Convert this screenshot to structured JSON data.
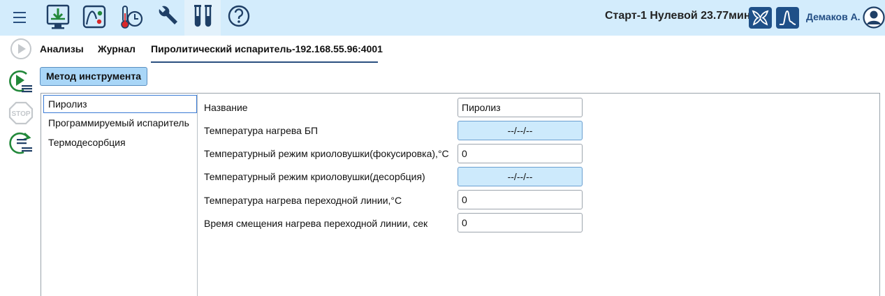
{
  "header": {
    "status_text": "Старт-1 Нулевой 23.77мин",
    "user_name": "Демаков А."
  },
  "toolbar_icons": [
    "monitor-download-icon",
    "chart-curve-icon",
    "thermometer-clock-icon",
    "wrench-icon",
    "test-tubes-icon",
    "help-icon"
  ],
  "colors": {
    "topbar": "#d3ecfc",
    "accent": "#1f5088",
    "green": "#22883a",
    "selected_button": "#a9d6f7",
    "value_blue": "#cdeafc"
  },
  "tabs": [
    {
      "label": "Анализы"
    },
    {
      "label": "Журнал"
    },
    {
      "label": "Пиролитический испаритель-192.168.55.96:4001"
    }
  ],
  "method_button_label": "Метод инструмента",
  "nav": {
    "items": [
      {
        "label": "Пиролиз"
      },
      {
        "label": "Программируемый испаритель"
      },
      {
        "label": "Термодесорбция"
      }
    ]
  },
  "form": {
    "rows": [
      {
        "label": "Название",
        "value": "Пиролиз"
      },
      {
        "label": "Температура нагрева БП",
        "value": "--/--/--"
      },
      {
        "label": "Температурный режим криоловушки(фокусировка),°C",
        "value": "0"
      },
      {
        "label": "Температурный режим криоловушки(десорбция)",
        "value": "--/--/--"
      },
      {
        "label": "Температура нагрева переходной линии,°C",
        "value": "0"
      },
      {
        "label": "Время смещения нагрева переходной линии, сек",
        "value": "0"
      }
    ]
  }
}
